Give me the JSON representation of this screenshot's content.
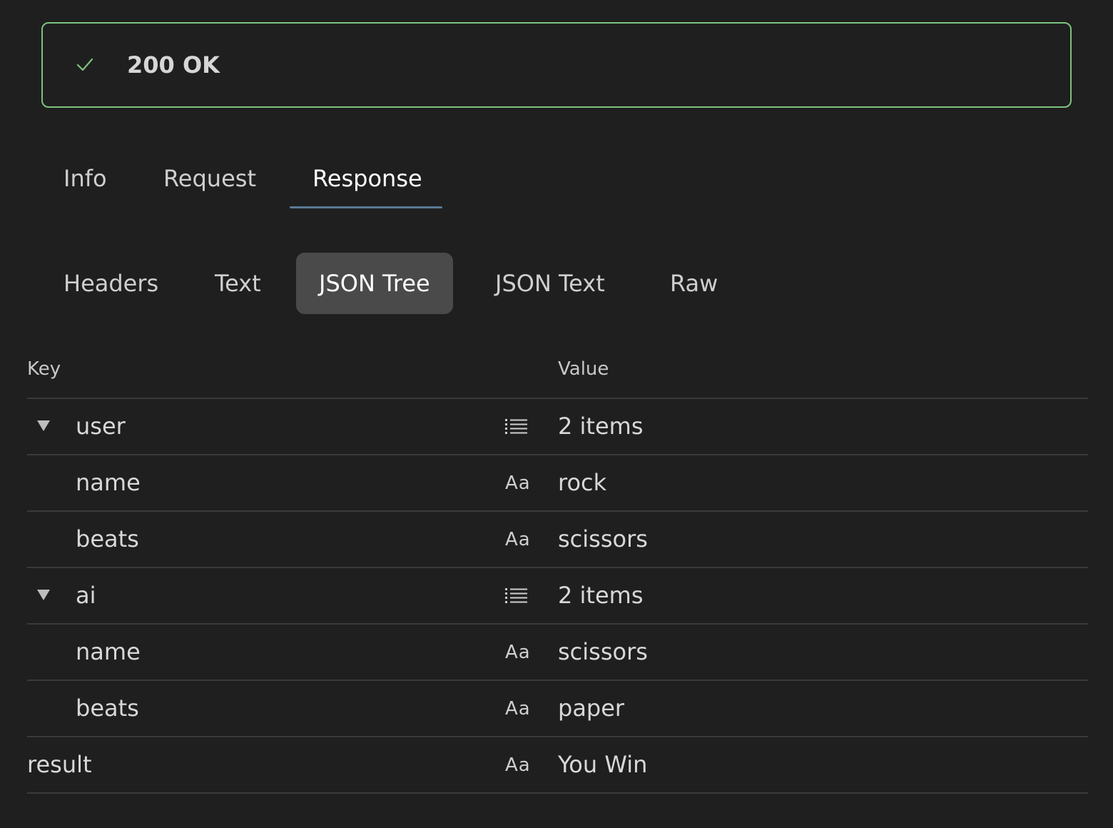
{
  "status": {
    "code": "200 OK",
    "color": "#7cc47f",
    "icon": "check-icon"
  },
  "tabs": [
    {
      "label": "Info",
      "active": false
    },
    {
      "label": "Request",
      "active": false
    },
    {
      "label": "Response",
      "active": true
    }
  ],
  "subtabs": [
    {
      "label": "Headers",
      "active": false
    },
    {
      "label": "Text",
      "active": false
    },
    {
      "label": "JSON Tree",
      "active": true
    },
    {
      "label": "JSON Text",
      "active": false
    },
    {
      "label": "Raw",
      "active": false
    }
  ],
  "tree": {
    "headers": {
      "key": "Key",
      "value": "Value"
    },
    "rows": [
      {
        "key": "user",
        "type": "object",
        "type_icon": "list-icon",
        "value": "2 items",
        "expandable": true
      },
      {
        "key": "name",
        "type": "string",
        "type_label": "Aa",
        "value": "rock"
      },
      {
        "key": "beats",
        "type": "string",
        "type_label": "Aa",
        "value": "scissors"
      },
      {
        "key": "ai",
        "type": "object",
        "type_icon": "list-icon",
        "value": "2 items",
        "expandable": true
      },
      {
        "key": "name",
        "type": "string",
        "type_label": "Aa",
        "value": "scissors"
      },
      {
        "key": "beats",
        "type": "string",
        "type_label": "Aa",
        "value": "paper"
      },
      {
        "key": "result",
        "type": "string",
        "type_label": "Aa",
        "value": "You Win"
      }
    ]
  }
}
